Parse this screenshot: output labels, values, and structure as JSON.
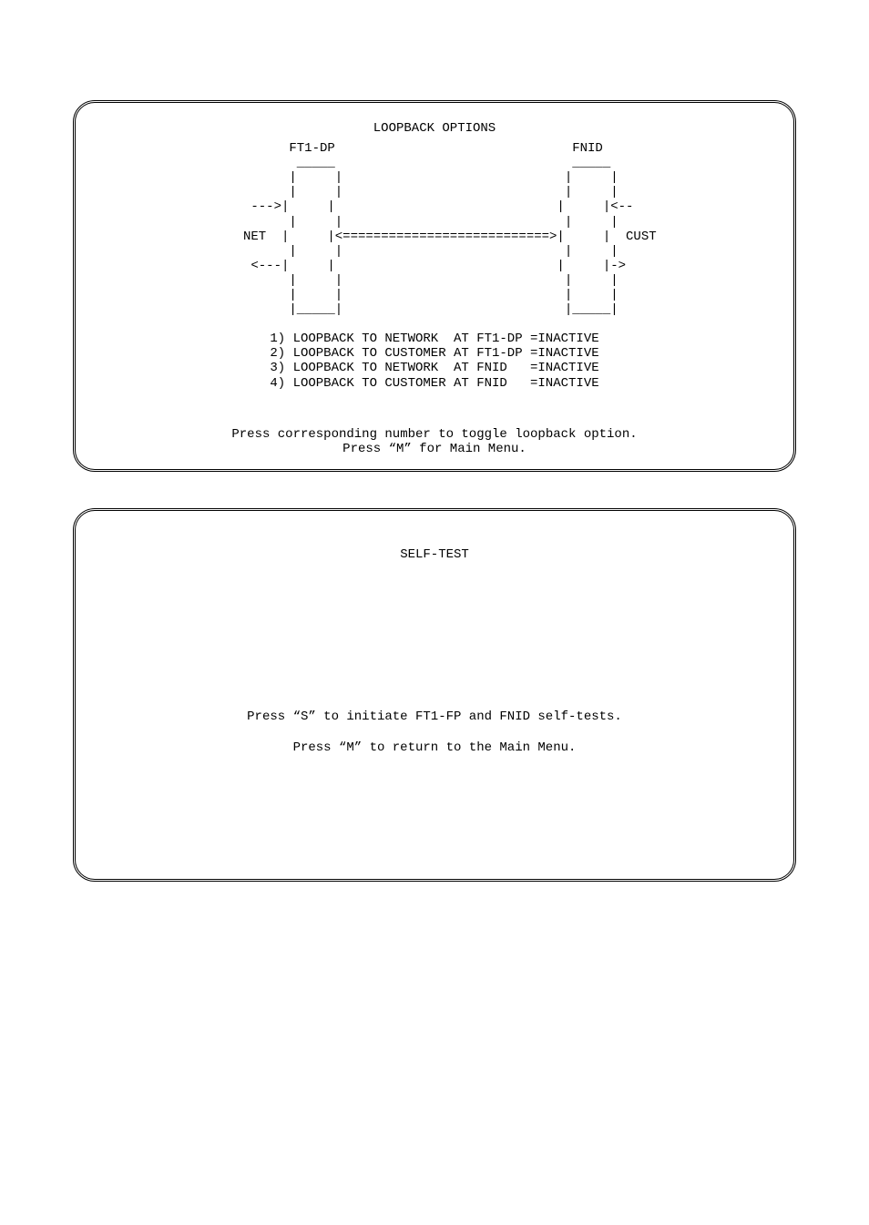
{
  "panel1": {
    "title": "LOOPBACK OPTIONS",
    "diagram": "          FT1-DP                               FNID\n           _____                               _____\n          |     |                             |     |\n          |     |                             |     |\n     --->|     |                             |     |<--\n          |     |                             |     |\n    NET  |     |<===========================>|     |  CUST\n          |     |                             |     |\n     <---|     |                             |     |->\n          |     |                             |     |\n          |     |                             |     |\n          |_____|                             |_____|",
    "options": [
      "1) LOOPBACK TO NETWORK  AT FT1-DP =INACTIVE",
      "2) LOOPBACK TO CUSTOMER AT FT1-DP =INACTIVE",
      "3) LOOPBACK TO NETWORK  AT FNID   =INACTIVE",
      "4) LOOPBACK TO CUSTOMER AT FNID   =INACTIVE"
    ],
    "instr1": "Press corresponding number to toggle loopback option.",
    "instr2": "Press “M” for Main Menu."
  },
  "panel2": {
    "title": "SELF-TEST",
    "line1": "Press “S” to initiate FT1-FP and FNID self-tests.",
    "line2": "Press “M” to return to the Main Menu."
  }
}
